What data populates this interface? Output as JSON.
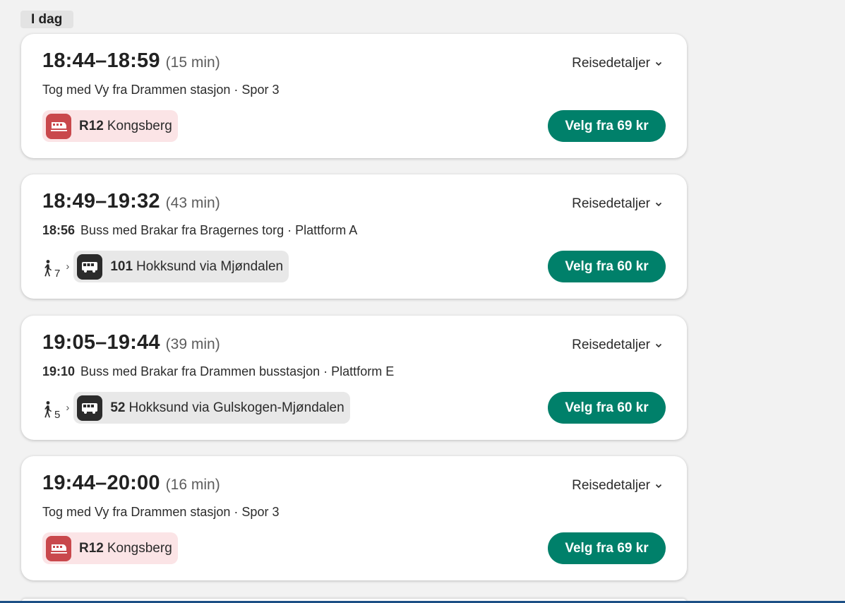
{
  "day_label": "I dag",
  "trips": [
    {
      "time_range": "18:44–18:59",
      "duration": "(15 min)",
      "details_label": "Reisedetaljer",
      "departure_time": "",
      "description": "Tog med Vy fra Drammen stasjon · Spor 3",
      "walk_minutes": "",
      "mode": "train",
      "line_number": "R12",
      "line_destination": "Kongsberg",
      "button_label": "Velg fra 69 kr"
    },
    {
      "time_range": "18:49–19:32",
      "duration": "(43 min)",
      "details_label": "Reisedetaljer",
      "departure_time": "18:56",
      "description": "Buss med Brakar fra Bragernes torg · Plattform A",
      "walk_minutes": "7",
      "mode": "bus",
      "line_number": "101",
      "line_destination": "Hokksund via Mjøndalen",
      "button_label": "Velg fra 60 kr"
    },
    {
      "time_range": "19:05–19:44",
      "duration": "(39 min)",
      "details_label": "Reisedetaljer",
      "departure_time": "19:10",
      "description": "Buss med Brakar fra Drammen busstasjon · Plattform E",
      "walk_minutes": "5",
      "mode": "bus",
      "line_number": "52",
      "line_destination": "Hokksund via Gulskogen-Mjøndalen",
      "button_label": "Velg fra 60 kr"
    },
    {
      "time_range": "19:44–20:00",
      "duration": "(16 min)",
      "details_label": "Reisedetaljer",
      "departure_time": "",
      "description": "Tog med Vy fra Drammen stasjon · Spor 3",
      "walk_minutes": "",
      "mode": "train",
      "line_number": "R12",
      "line_destination": "Kongsberg",
      "button_label": "Velg fra 69 kr"
    }
  ],
  "icons": {
    "train": "train-icon",
    "bus": "bus-icon",
    "walk": "walking-person-icon",
    "details_chevron": "chevron-down-icon",
    "leg_separator": "chevron-right-icon"
  },
  "colors": {
    "button": "#00806a",
    "train_badge": "#c9484c",
    "train_chip": "#fbe4e6",
    "bus_badge": "#2b2b2b",
    "bus_chip": "#e8e8e8"
  }
}
